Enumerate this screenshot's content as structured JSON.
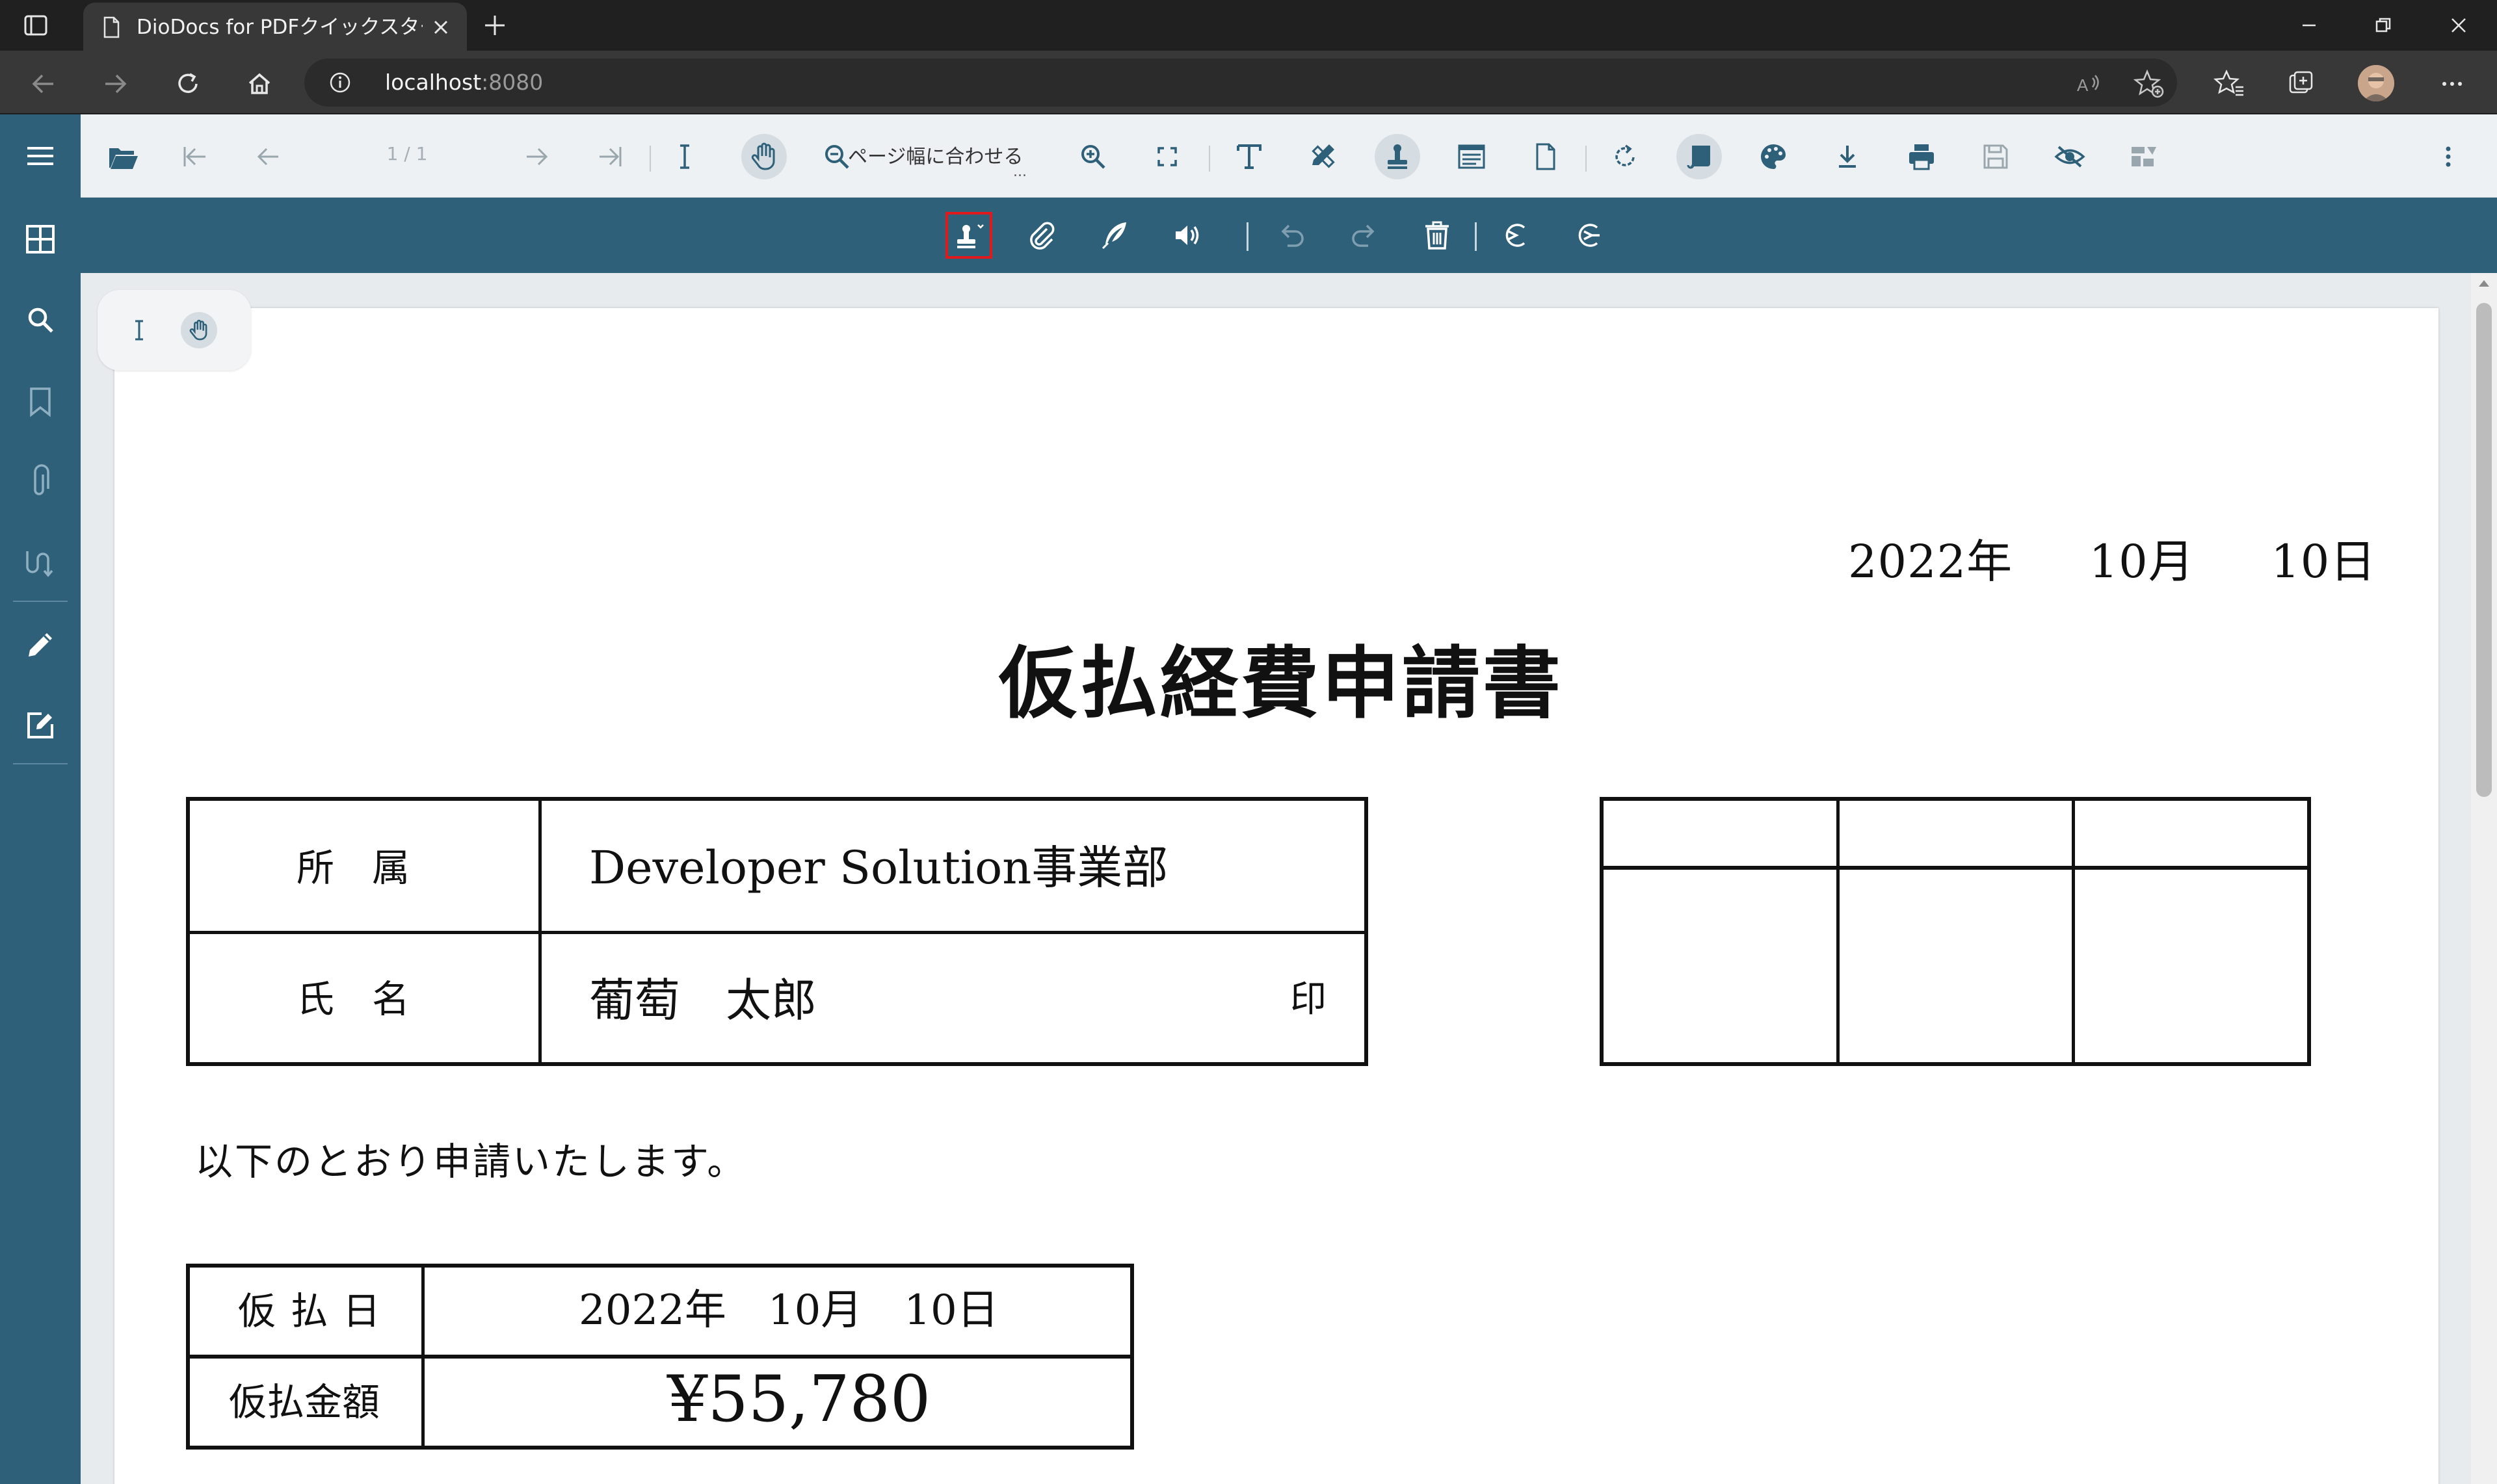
{
  "browser": {
    "tab_title": "DioDocs for PDFクイックスタート | P",
    "url_host": "localhost",
    "url_port": ":8080"
  },
  "viewer": {
    "page_indicator": "1 / 1",
    "zoom_label": "ページ幅に合わせる",
    "zoom_more": "..."
  },
  "document": {
    "date": "2022年　  10月　  10日",
    "title": "仮払経費申請書",
    "applicant_table": {
      "dept_label": "所　属",
      "dept_value": "Developer Solution事業部",
      "name_label": "氏　名",
      "name_value": "葡萄　太郎",
      "seal_label": "印"
    },
    "intro_text": "以下のとおり申請いたします。",
    "payment_table": {
      "date_label": "仮 払 日",
      "date_value": "2022年　10月　10日",
      "amount_label": "仮払金額",
      "amount_value": "¥55,780"
    }
  },
  "colors": {
    "sidebar": "#2f6079",
    "toolbar": "#eef1f3",
    "selected_outline": "#e0191c"
  }
}
